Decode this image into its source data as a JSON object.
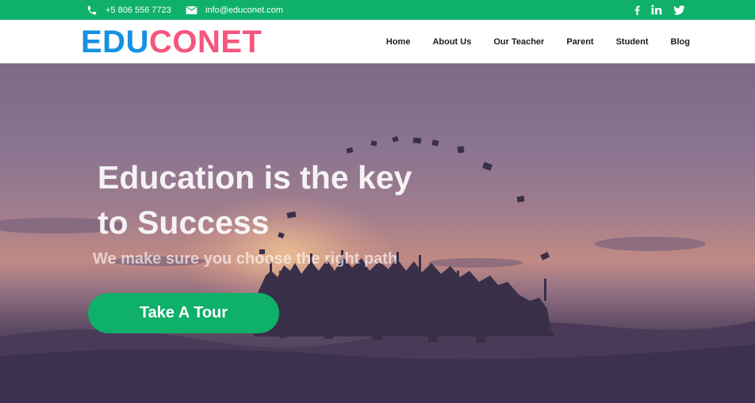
{
  "topbar": {
    "phone": "+5 806 556 7723",
    "email": "info@educonet.com",
    "phone_icon": "phone-icon",
    "email_icon": "mail-icon",
    "socials": [
      "facebook-icon",
      "linkedin-icon",
      "twitter-icon"
    ]
  },
  "brand": {
    "part1": "EDU",
    "part2": "CONET",
    "color1": "#1591e3",
    "color2": "#f5567d"
  },
  "nav": {
    "items": [
      "Home",
      "About Us",
      "Our Teacher",
      "Parent",
      "Student",
      "Blog"
    ]
  },
  "hero": {
    "line1": "Education is the key",
    "line2": "to Success",
    "subtitle": "We make sure you choose the right path",
    "cta_label": "Take A Tour"
  },
  "colors": {
    "accent_green": "#0fb06a"
  }
}
